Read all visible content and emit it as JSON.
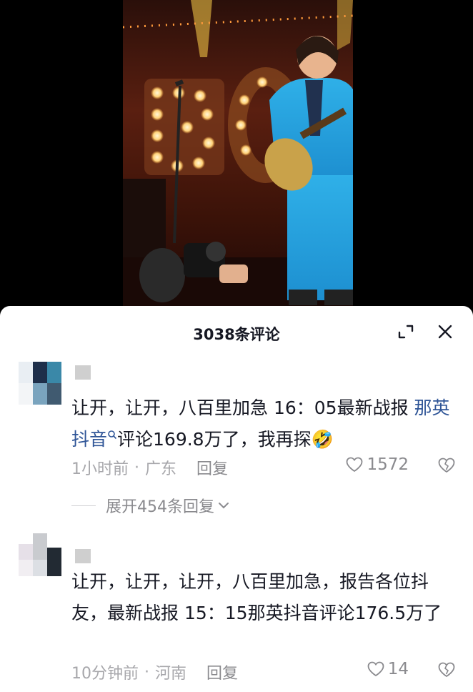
{
  "sheet": {
    "title": "3038条评论"
  },
  "comments": [
    {
      "text_before": "让开，让开，八百里加急  16：05最新战报",
      "link": "那英抖音",
      "text_after": "评论169.8万了，我再探",
      "emoji": "🤣",
      "time": "1小时前",
      "location": "广东",
      "reply_label": "回复",
      "likes": "1572",
      "expand_label": "展开454条回复"
    },
    {
      "text": "让开，让开，让开，八百里加急，报告各位抖友，最新战报 15：15那英抖音评论176.5万了",
      "time": "10分钟前",
      "location": "河南",
      "reply_label": "回复",
      "likes": "14"
    }
  ],
  "icons": {
    "minimize": "minimize-corner-icon",
    "close": "close-icon",
    "like": "heart-outline-icon",
    "dislike": "broken-heart-icon",
    "expand": "chevron-down-icon",
    "search_hint": "search-icon"
  },
  "colors": {
    "link": "#2f5597",
    "muted": "#a7a7ab",
    "text": "#161823"
  }
}
